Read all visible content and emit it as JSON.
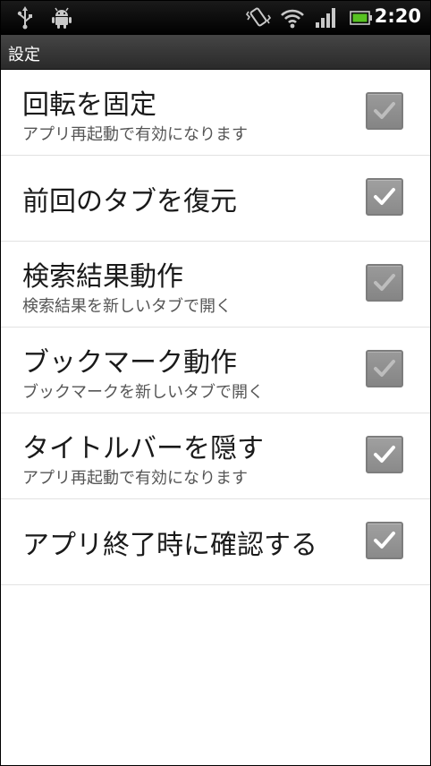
{
  "status_bar": {
    "time": "2:20",
    "icons": [
      "usb-icon",
      "android-icon",
      "vibrate-icon",
      "wifi-icon",
      "signal-icon",
      "battery-icon"
    ]
  },
  "title_bar": {
    "title": "設定"
  },
  "settings": [
    {
      "title": "回転を固定",
      "subtitle": "アプリ再起動で有効になります",
      "checked": true
    },
    {
      "title": "前回のタブを復元",
      "subtitle": "",
      "checked": true
    },
    {
      "title": "検索結果動作",
      "subtitle": "検索結果を新しいタブで開く",
      "checked": true
    },
    {
      "title": "ブックマーク動作",
      "subtitle": "ブックマークを新しいタブで開く",
      "checked": true
    },
    {
      "title": "タイトルバーを隠す",
      "subtitle": "アプリ再起動で有効になります",
      "checked": true
    },
    {
      "title": "アプリ終了時に確認する",
      "subtitle": "",
      "checked": true
    }
  ],
  "colors": {
    "status_bar_bg": "#000000",
    "title_bar_bg": "#3a3a3a",
    "battery_green": "#58c322"
  }
}
